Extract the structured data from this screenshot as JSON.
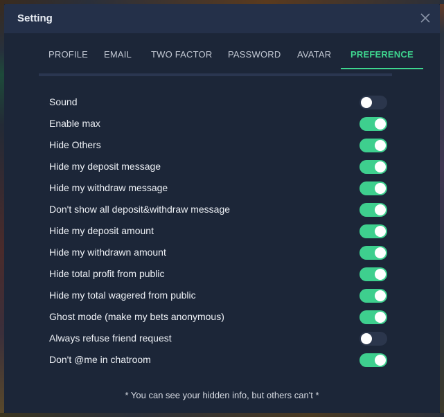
{
  "modal": {
    "title": "Setting",
    "close_icon": "close-icon"
  },
  "tabs": [
    {
      "label": "PROFILE",
      "active": false
    },
    {
      "label": "EMAIL",
      "active": false
    },
    {
      "label": "TWO FACTOR",
      "active": false
    },
    {
      "label": "PASSWORD",
      "active": false
    },
    {
      "label": "AVATAR",
      "active": false
    },
    {
      "label": "PREFERENCE",
      "active": true
    }
  ],
  "settings": [
    {
      "label": "Sound",
      "on": false
    },
    {
      "label": "Enable max",
      "on": true
    },
    {
      "label": "Hide Others",
      "on": true
    },
    {
      "label": "Hide my deposit message",
      "on": true
    },
    {
      "label": "Hide my withdraw message",
      "on": true
    },
    {
      "label": "Don't show all deposit&withdraw message",
      "on": true
    },
    {
      "label": "Hide my deposit amount",
      "on": true
    },
    {
      "label": "Hide my withdrawn amount",
      "on": true
    },
    {
      "label": "Hide total profit from public",
      "on": true
    },
    {
      "label": "Hide my total wagered from public",
      "on": true
    },
    {
      "label": "Ghost mode (make my bets anonymous)",
      "on": true
    },
    {
      "label": "Always refuse friend request",
      "on": false
    },
    {
      "label": "Don't @me in chatroom",
      "on": true
    }
  ],
  "footnote": "* You can see your hidden info, but others can't *",
  "colors": {
    "accent": "#3ecf8e",
    "modal_bg": "#1c2638",
    "header_bg": "#243049",
    "toggle_off": "#2b364c"
  }
}
